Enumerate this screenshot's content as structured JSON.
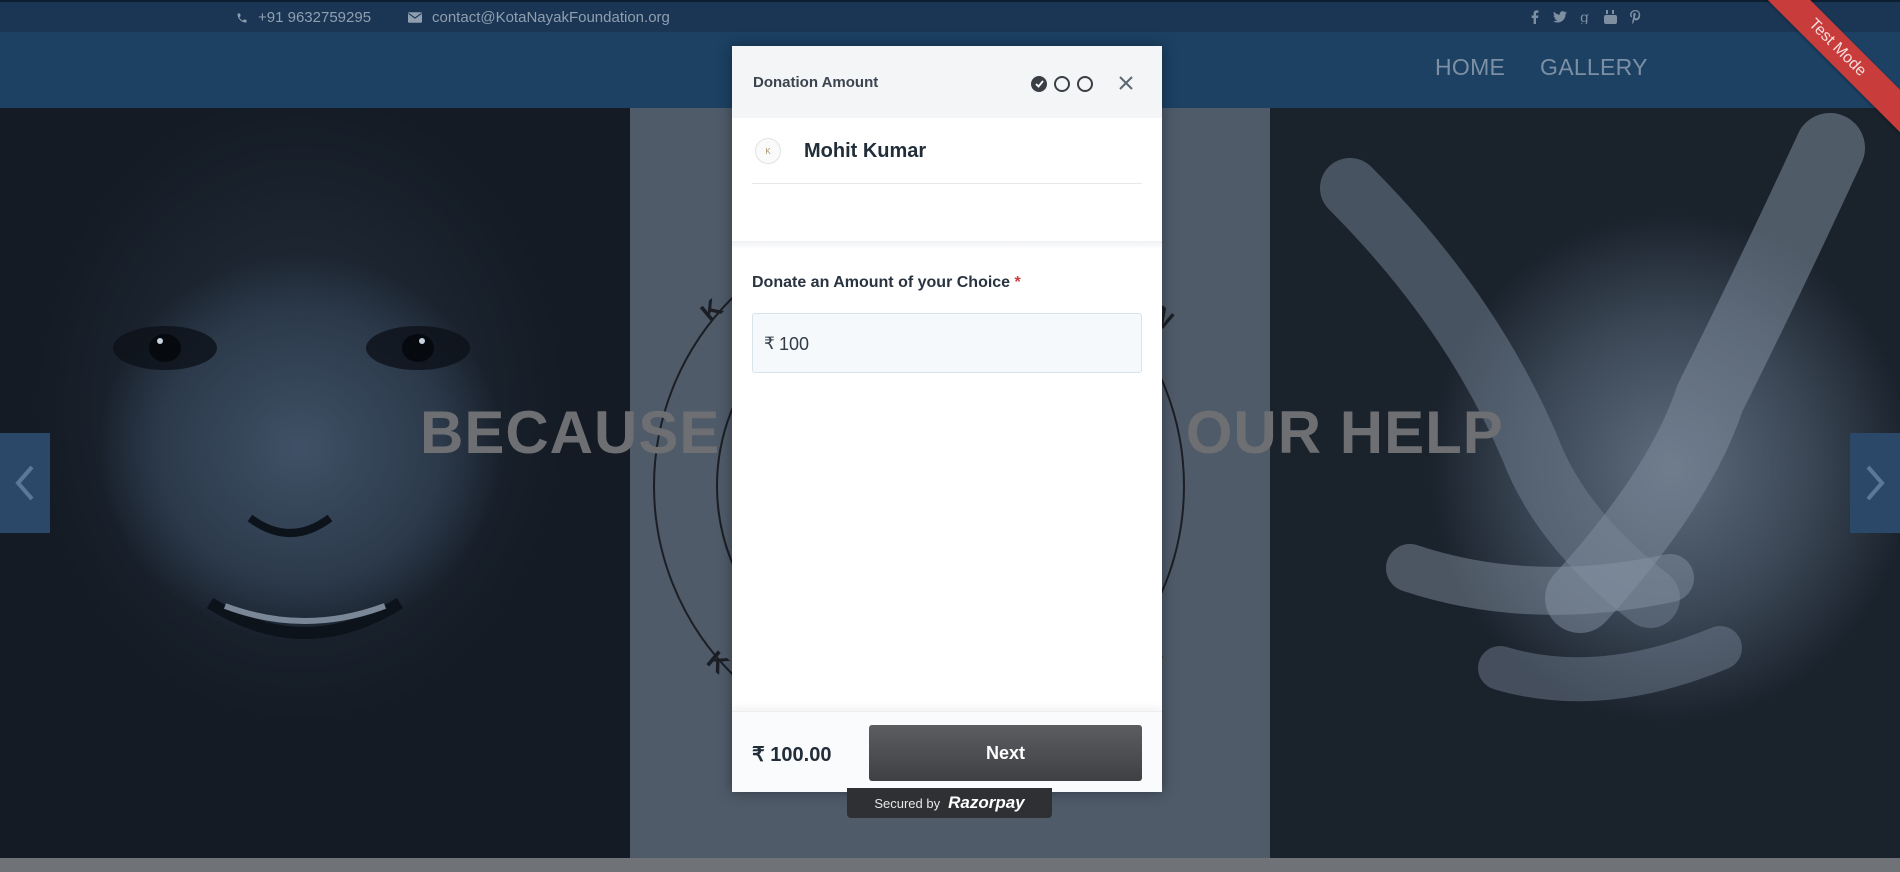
{
  "topbar": {
    "phone": "+91 9632759295",
    "email": "contact@KotaNayakFoundation.org",
    "social": [
      "facebook-icon",
      "twitter-icon",
      "google-plus-icon",
      "youtube-icon",
      "pinterest-icon"
    ]
  },
  "nav": {
    "items": [
      {
        "label": "HOME"
      },
      {
        "label": "GALLERY"
      }
    ]
  },
  "hero": {
    "headline_left": "BECAUSE",
    "headline_right": "OUR HELP",
    "ribbon": "Test Mode"
  },
  "modal": {
    "title": "Donation Amount",
    "steps": [
      {
        "state": "done"
      },
      {
        "state": "pending"
      },
      {
        "state": "pending"
      }
    ],
    "merchant": {
      "logo_text": "K",
      "name": "Mohit Kumar"
    },
    "amount_label": "Donate an Amount of your Choice",
    "required_mark": "*",
    "currency_symbol": "₹",
    "amount_value": "100",
    "footer_amount": "₹ 100.00",
    "next_label": "Next"
  },
  "secured": {
    "by": "Secured by",
    "brand": "Razorpay"
  },
  "colors": {
    "topbar_bg": "#1b3654",
    "nav_bg": "#1c4163",
    "ribbon": "#c93c3c",
    "button": "#4a4b4e"
  }
}
